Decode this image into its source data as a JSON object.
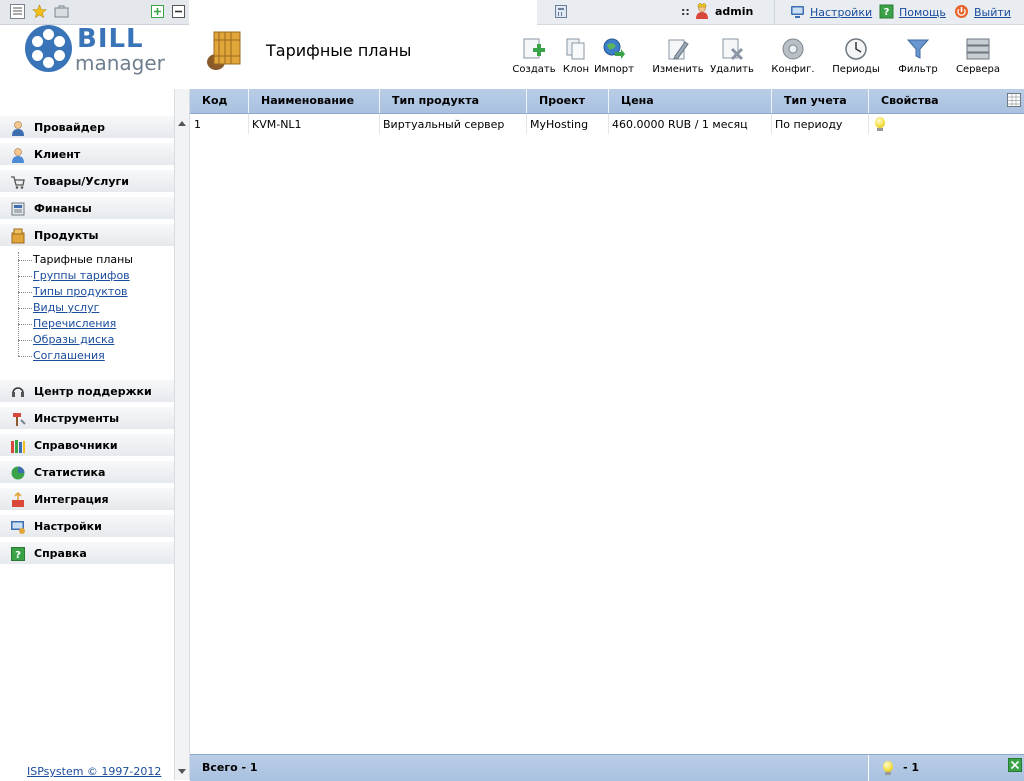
{
  "topbar": {
    "user_prefix": "::",
    "user_name": "admin",
    "links": [
      {
        "label": "Настройки",
        "icon": "settings-icon"
      },
      {
        "label": "Помощь",
        "icon": "help-icon"
      },
      {
        "label": "Выйти",
        "icon": "logout-icon"
      }
    ]
  },
  "logo": {
    "bill": "BILL",
    "manager": "manager"
  },
  "page": {
    "title": "Тарифные планы"
  },
  "toolbar": [
    {
      "label": "Создать",
      "icon": "create-icon"
    },
    {
      "label": "Клон",
      "icon": "clone-icon"
    },
    {
      "label": "Импорт",
      "icon": "import-icon"
    },
    {
      "label": "Изменить",
      "icon": "edit-icon"
    },
    {
      "label": "Удалить",
      "icon": "delete-icon"
    },
    {
      "label": "Конфиг.",
      "icon": "config-icon"
    },
    {
      "label": "Периоды",
      "icon": "periods-icon"
    },
    {
      "label": "Фильтр",
      "icon": "filter-icon"
    },
    {
      "label": "Сервера",
      "icon": "servers-icon"
    }
  ],
  "sidebar": {
    "menu": [
      {
        "label": "Провайдер",
        "icon": "provider-icon"
      },
      {
        "label": "Клиент",
        "icon": "client-icon"
      },
      {
        "label": "Товары/Услуги",
        "icon": "cart-icon"
      },
      {
        "label": "Финансы",
        "icon": "finance-icon"
      },
      {
        "label": "Продукты",
        "icon": "products-icon"
      }
    ],
    "submenu": [
      {
        "label": "Тарифные планы",
        "active": true
      },
      {
        "label": "Группы тарифов",
        "active": false
      },
      {
        "label": "Типы продуктов",
        "active": false
      },
      {
        "label": "Виды услуг",
        "active": false
      },
      {
        "label": "Перечисления",
        "active": false
      },
      {
        "label": "Образы диска",
        "active": false
      },
      {
        "label": "Соглашения",
        "active": false
      }
    ],
    "menu2": [
      {
        "label": "Центр поддержки",
        "icon": "support-icon"
      },
      {
        "label": "Инструменты",
        "icon": "tools-icon"
      },
      {
        "label": "Справочники",
        "icon": "reference-icon"
      },
      {
        "label": "Статистика",
        "icon": "statistics-icon"
      },
      {
        "label": "Интеграция",
        "icon": "integration-icon"
      },
      {
        "label": "Настройки",
        "icon": "settings-icon"
      },
      {
        "label": "Справка",
        "icon": "help-icon"
      }
    ],
    "copyright": "ISPsystem © 1997-2012"
  },
  "table": {
    "columns": [
      "Код",
      "Наименование",
      "Тип продукта",
      "Проект",
      "Цена",
      "Тип учета",
      "Свойства"
    ],
    "rows": [
      {
        "code": "1",
        "name": "KVM-NL1",
        "type": "Виртуальный сервер",
        "project": "MyHosting",
        "price": "460.0000 RUB / 1 месяц",
        "accounting": "По периоду",
        "props_icon": "bulb-icon"
      }
    ]
  },
  "footer": {
    "total": "Всего - 1",
    "count": "- 1"
  },
  "colors": {
    "header_blue": "#b3c9e4",
    "link": "#1a4d9c",
    "logo_blue": "#3a74b8"
  }
}
